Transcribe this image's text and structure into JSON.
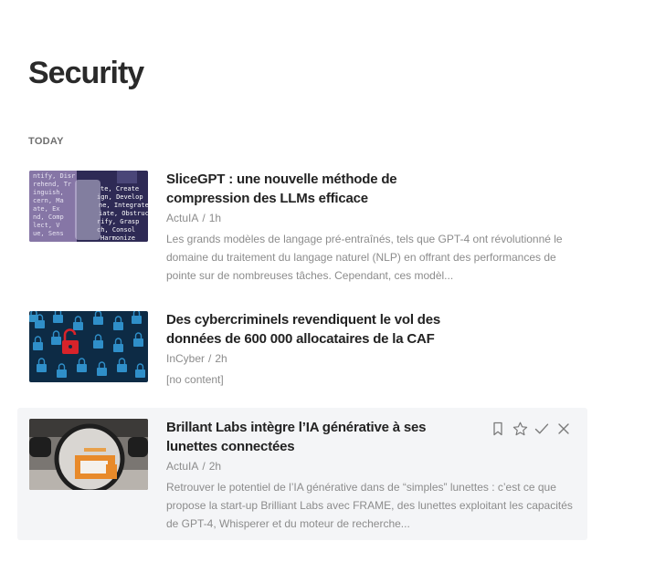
{
  "page": {
    "title": "Security",
    "section_label": "TODAY"
  },
  "articles": [
    {
      "title": "SliceGPT : une nouvelle méthode de compression des LLMs efficace",
      "source": "ActuIA",
      "separator": "/",
      "age": "1h",
      "summary": "Les grands modèles de langage pré-entraînés, tels que GPT-4 ont révolutionné le domaine du traitement du langage naturel (NLP) en offrant des performances de pointe sur de nombreuses tâches. Cependant, ces modèl..."
    },
    {
      "title": "Des cybercriminels revendiquent le vol des données de 600 000 allocataires de la CAF",
      "source": "InCyber",
      "separator": "/",
      "age": "2h",
      "summary": "[no content]"
    },
    {
      "title": "Brillant Labs intègre l’IA générative à ses lunettes connectées",
      "source": "ActuIA",
      "separator": "/",
      "age": "2h",
      "summary": "Retrouver le potentiel de l’IA générative dans de “simples” lunettes : c’est ce que propose la start-up Brilliant Labs avec FRAME, des lunettes exploitant les capacités de GPT-4, Whisperer et du moteur de recherche..."
    }
  ],
  "actions": {
    "icons": [
      "bookmark-icon",
      "star-icon",
      "check-icon",
      "close-icon"
    ]
  },
  "colors": {
    "hover_bg": "#f4f5f7",
    "title": "#222222",
    "muted": "#8c8c8c",
    "icon": "#7a7a7a"
  }
}
